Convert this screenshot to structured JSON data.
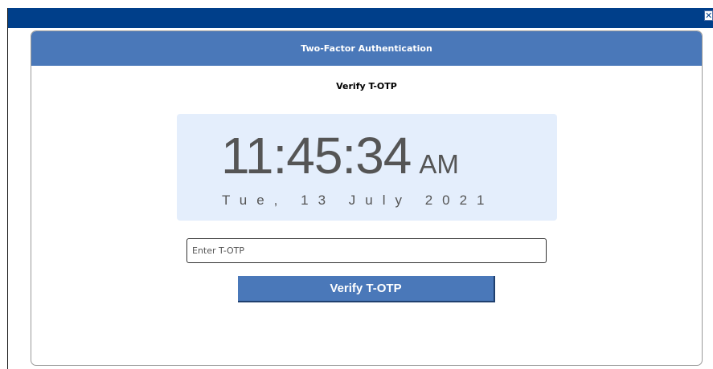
{
  "window": {
    "close_glyph": "✕",
    "close_icon": "close-icon"
  },
  "panel": {
    "title": "Two-Factor Authentication",
    "subtitle": "Verify T-OTP"
  },
  "clock": {
    "time": "11:45:34",
    "ampm": "AM",
    "date": "Tue, 13 July 2021"
  },
  "form": {
    "otp_placeholder": "Enter T-OTP",
    "otp_value": "",
    "verify_label": "Verify T-OTP"
  },
  "colors": {
    "topbar": "#003f8a",
    "header": "#4a78b9",
    "clock_bg": "#e4eefc",
    "button": "#4a78b9"
  }
}
